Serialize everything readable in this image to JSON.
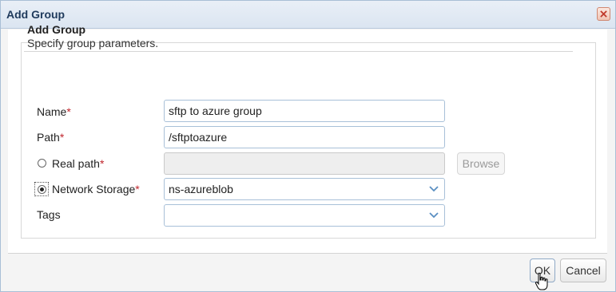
{
  "dialog": {
    "title": "Add Group",
    "close_icon": "close-icon"
  },
  "section": {
    "title": "Add Group",
    "subtitle": "Specify group parameters."
  },
  "fields": {
    "name": {
      "label": "Name",
      "required_mark": "*",
      "value": "sftp to azure group"
    },
    "path": {
      "label": "Path",
      "required_mark": "*",
      "value": "/sftptoazure"
    },
    "real_path": {
      "label": "Real path",
      "required_mark": "*",
      "value": "",
      "selected": false
    },
    "browse_label": "Browse",
    "network_storage": {
      "label": "Network Storage",
      "required_mark": "*",
      "value": "ns-azureblob",
      "selected": true
    },
    "tags": {
      "label": "Tags",
      "value": ""
    }
  },
  "footer": {
    "ok_label": "OK",
    "cancel_label": "Cancel"
  },
  "colors": {
    "accent": "#1f3a5c",
    "required": "#c0262d",
    "input_border": "#a8c0d8",
    "dropdown_arrow": "#5a8fc2"
  }
}
